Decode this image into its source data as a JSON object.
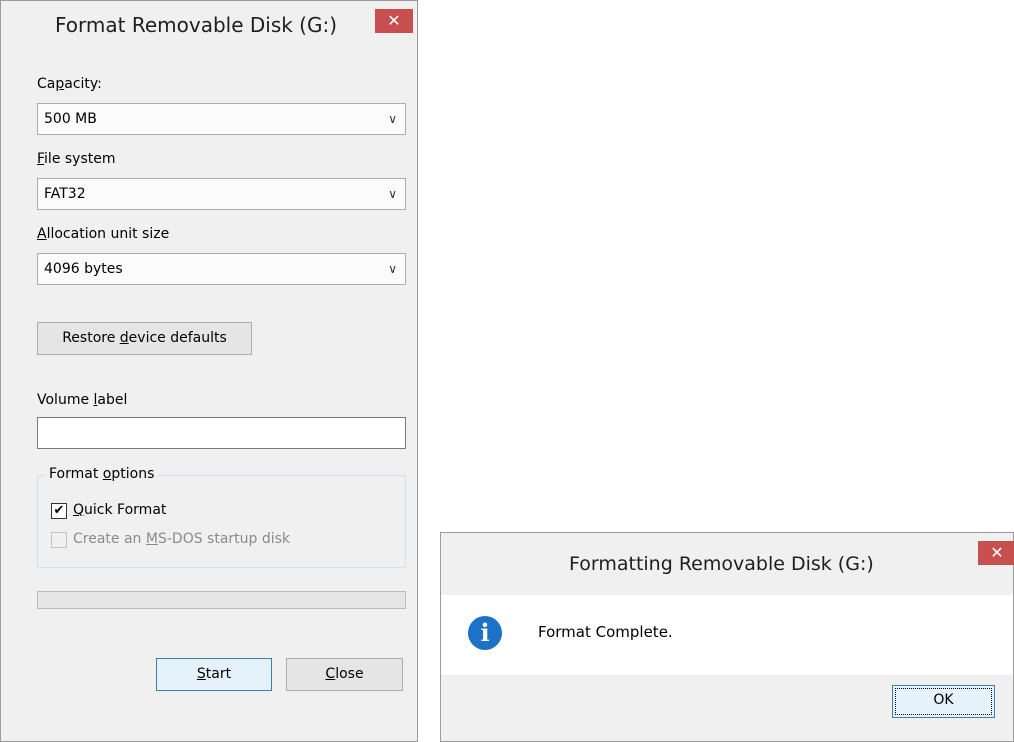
{
  "format_dialog": {
    "title": "Format Removable Disk (G:)",
    "close_glyph": "✕",
    "capacity": {
      "label_pre": "Ca",
      "label_u": "p",
      "label_post": "acity:",
      "value": "500 MB"
    },
    "file_system": {
      "label_pre": "",
      "label_u": "F",
      "label_post": "ile system",
      "value": "FAT32"
    },
    "allocation": {
      "label_pre": "",
      "label_u": "A",
      "label_post": "llocation unit size",
      "value": "4096 bytes"
    },
    "restore_button": {
      "pre": "Restore ",
      "u": "d",
      "post": "evice defaults"
    },
    "volume_label": {
      "pre": "Volume ",
      "u": "l",
      "post": "abel",
      "value": ""
    },
    "format_options": {
      "title_pre": "Format ",
      "title_u": "o",
      "title_post": "ptions",
      "quick_format": {
        "u": "Q",
        "post": "uick Format",
        "checked": true
      },
      "msdos": {
        "pre": "Create an ",
        "u": "M",
        "post": "S-DOS startup disk",
        "checked": false,
        "enabled": false
      }
    },
    "progress_percent": 0,
    "start_button": {
      "u": "S",
      "post": "tart"
    },
    "close_button": {
      "u": "C",
      "post": "lose"
    },
    "chevron_glyph": "∨",
    "check_glyph": "✔"
  },
  "complete_dialog": {
    "title": "Formatting Removable Disk (G:)",
    "close_glyph": "✕",
    "message": "Format Complete.",
    "icon_glyph": "i",
    "ok_button": "OK"
  },
  "colors": {
    "close_red": "#c74f4f",
    "info_blue": "#1b72c6",
    "dialog_bg": "#f0f0f0"
  }
}
